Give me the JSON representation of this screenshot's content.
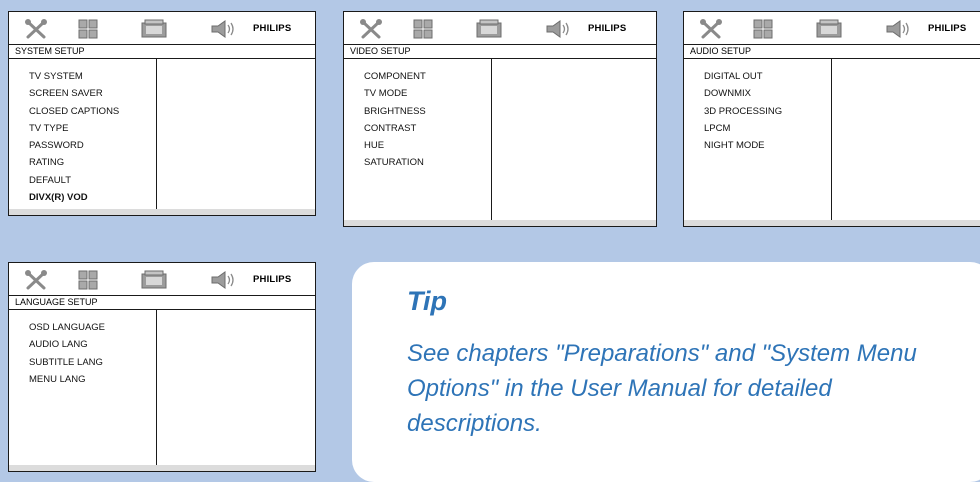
{
  "brand": "PHILIPS",
  "icons": {
    "tools": "tools-icon",
    "grid": "grid-icon",
    "video": "video-icon",
    "audio": "audio-icon"
  },
  "panels": {
    "system": {
      "title": "SYSTEM SETUP",
      "items": [
        "TV SYSTEM",
        "SCREEN SAVER",
        "CLOSED CAPTIONS",
        "TV TYPE",
        "PASSWORD",
        "RATING",
        "DEFAULT",
        "DIVX(R) VOD"
      ]
    },
    "video": {
      "title": "VIDEO SETUP",
      "items": [
        "COMPONENT",
        "TV MODE",
        "BRIGHTNESS",
        "CONTRAST",
        "HUE",
        "SATURATION"
      ]
    },
    "audio": {
      "title": "AUDIO SETUP",
      "items": [
        "DIGITAL OUT",
        "DOWNMIX",
        "3D PROCESSING",
        "LPCM",
        "NIGHT MODE"
      ]
    },
    "language": {
      "title": "LANGUAGE SETUP",
      "items": [
        "OSD LANGUAGE",
        "AUDIO LANG",
        "SUBTITLE LANG",
        "MENU LANG"
      ]
    }
  },
  "tip": {
    "heading": "Tip",
    "text": "See chapters \"Preparations\" and \"System Menu Options\" in the User Manual for detailed descriptions."
  },
  "colors": {
    "background": "#b3c8e6",
    "tip_text": "#2e74b7"
  }
}
